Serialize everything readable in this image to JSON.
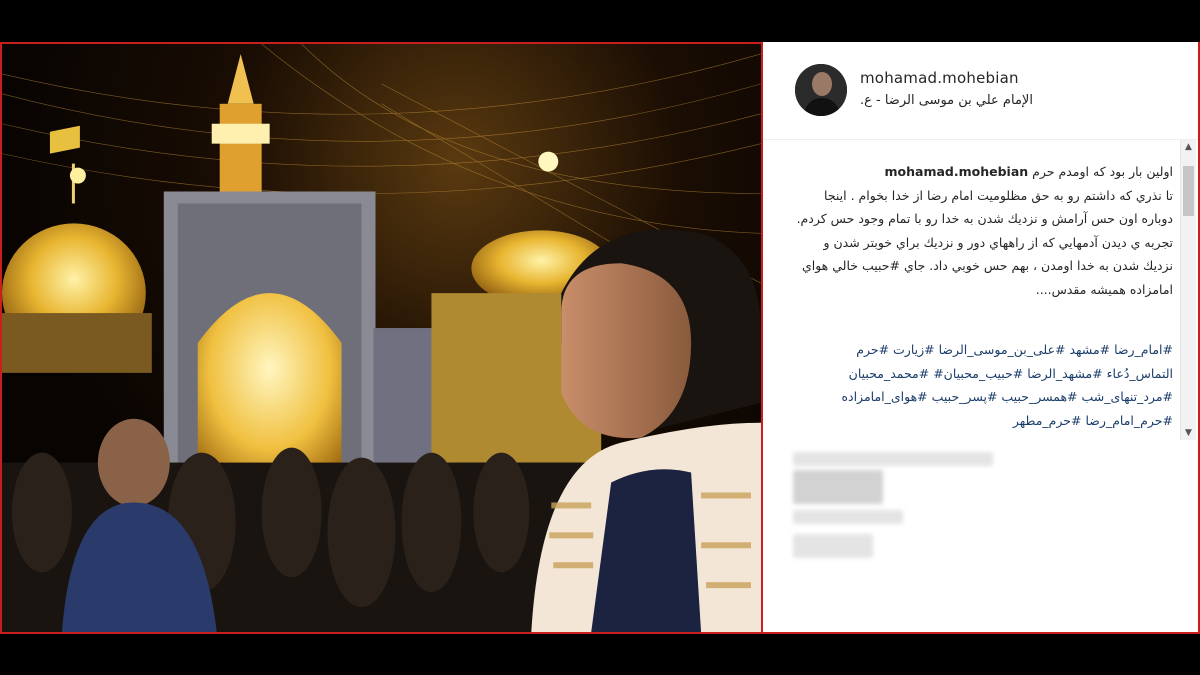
{
  "post": {
    "username": "mohamad.mohebian",
    "location": "الإمام علي بن موسى الرضا - ع."
  },
  "caption": {
    "username": "mohamad.mohebian",
    "line1": "اولين بار بود كه اومدم حرم",
    "body": "تا نذري كه داشتم رو به حق مظلوميت امام رضا از خدا بخوام . اينجا دوباره اون حس آرامش و نزديك شدن به خدا رو با تمام وجود حس كردم. تجربه ي ديدن آدمهايي كه از راههاي دور و نزديك براي خوبتر شدن و نزديك شدن به خدا اومدن ، بهم حس خوبي داد. جاي #حبيب خالي هواي امامزاده هميشه مقدس....",
    "hashtags": "#امام_رضا #مشهد #علی_بن_موسی_الرضا #زیارت #حرم التماس_دُعاء #مشهد_الرضا #حبیب_محبیان# #محمد_محبیان #مرد_تنهای_شب #همسر_حبیب #پسر_حبیب #هوای_امامزاده #حرم_امام_رضا #حرم_مطهر"
  },
  "colors": {
    "hashtag": "#1b3d6b",
    "border": "#c81e1e",
    "text": "#262626"
  },
  "icons": {
    "scroll_up": "▲",
    "scroll_down": "▼"
  }
}
